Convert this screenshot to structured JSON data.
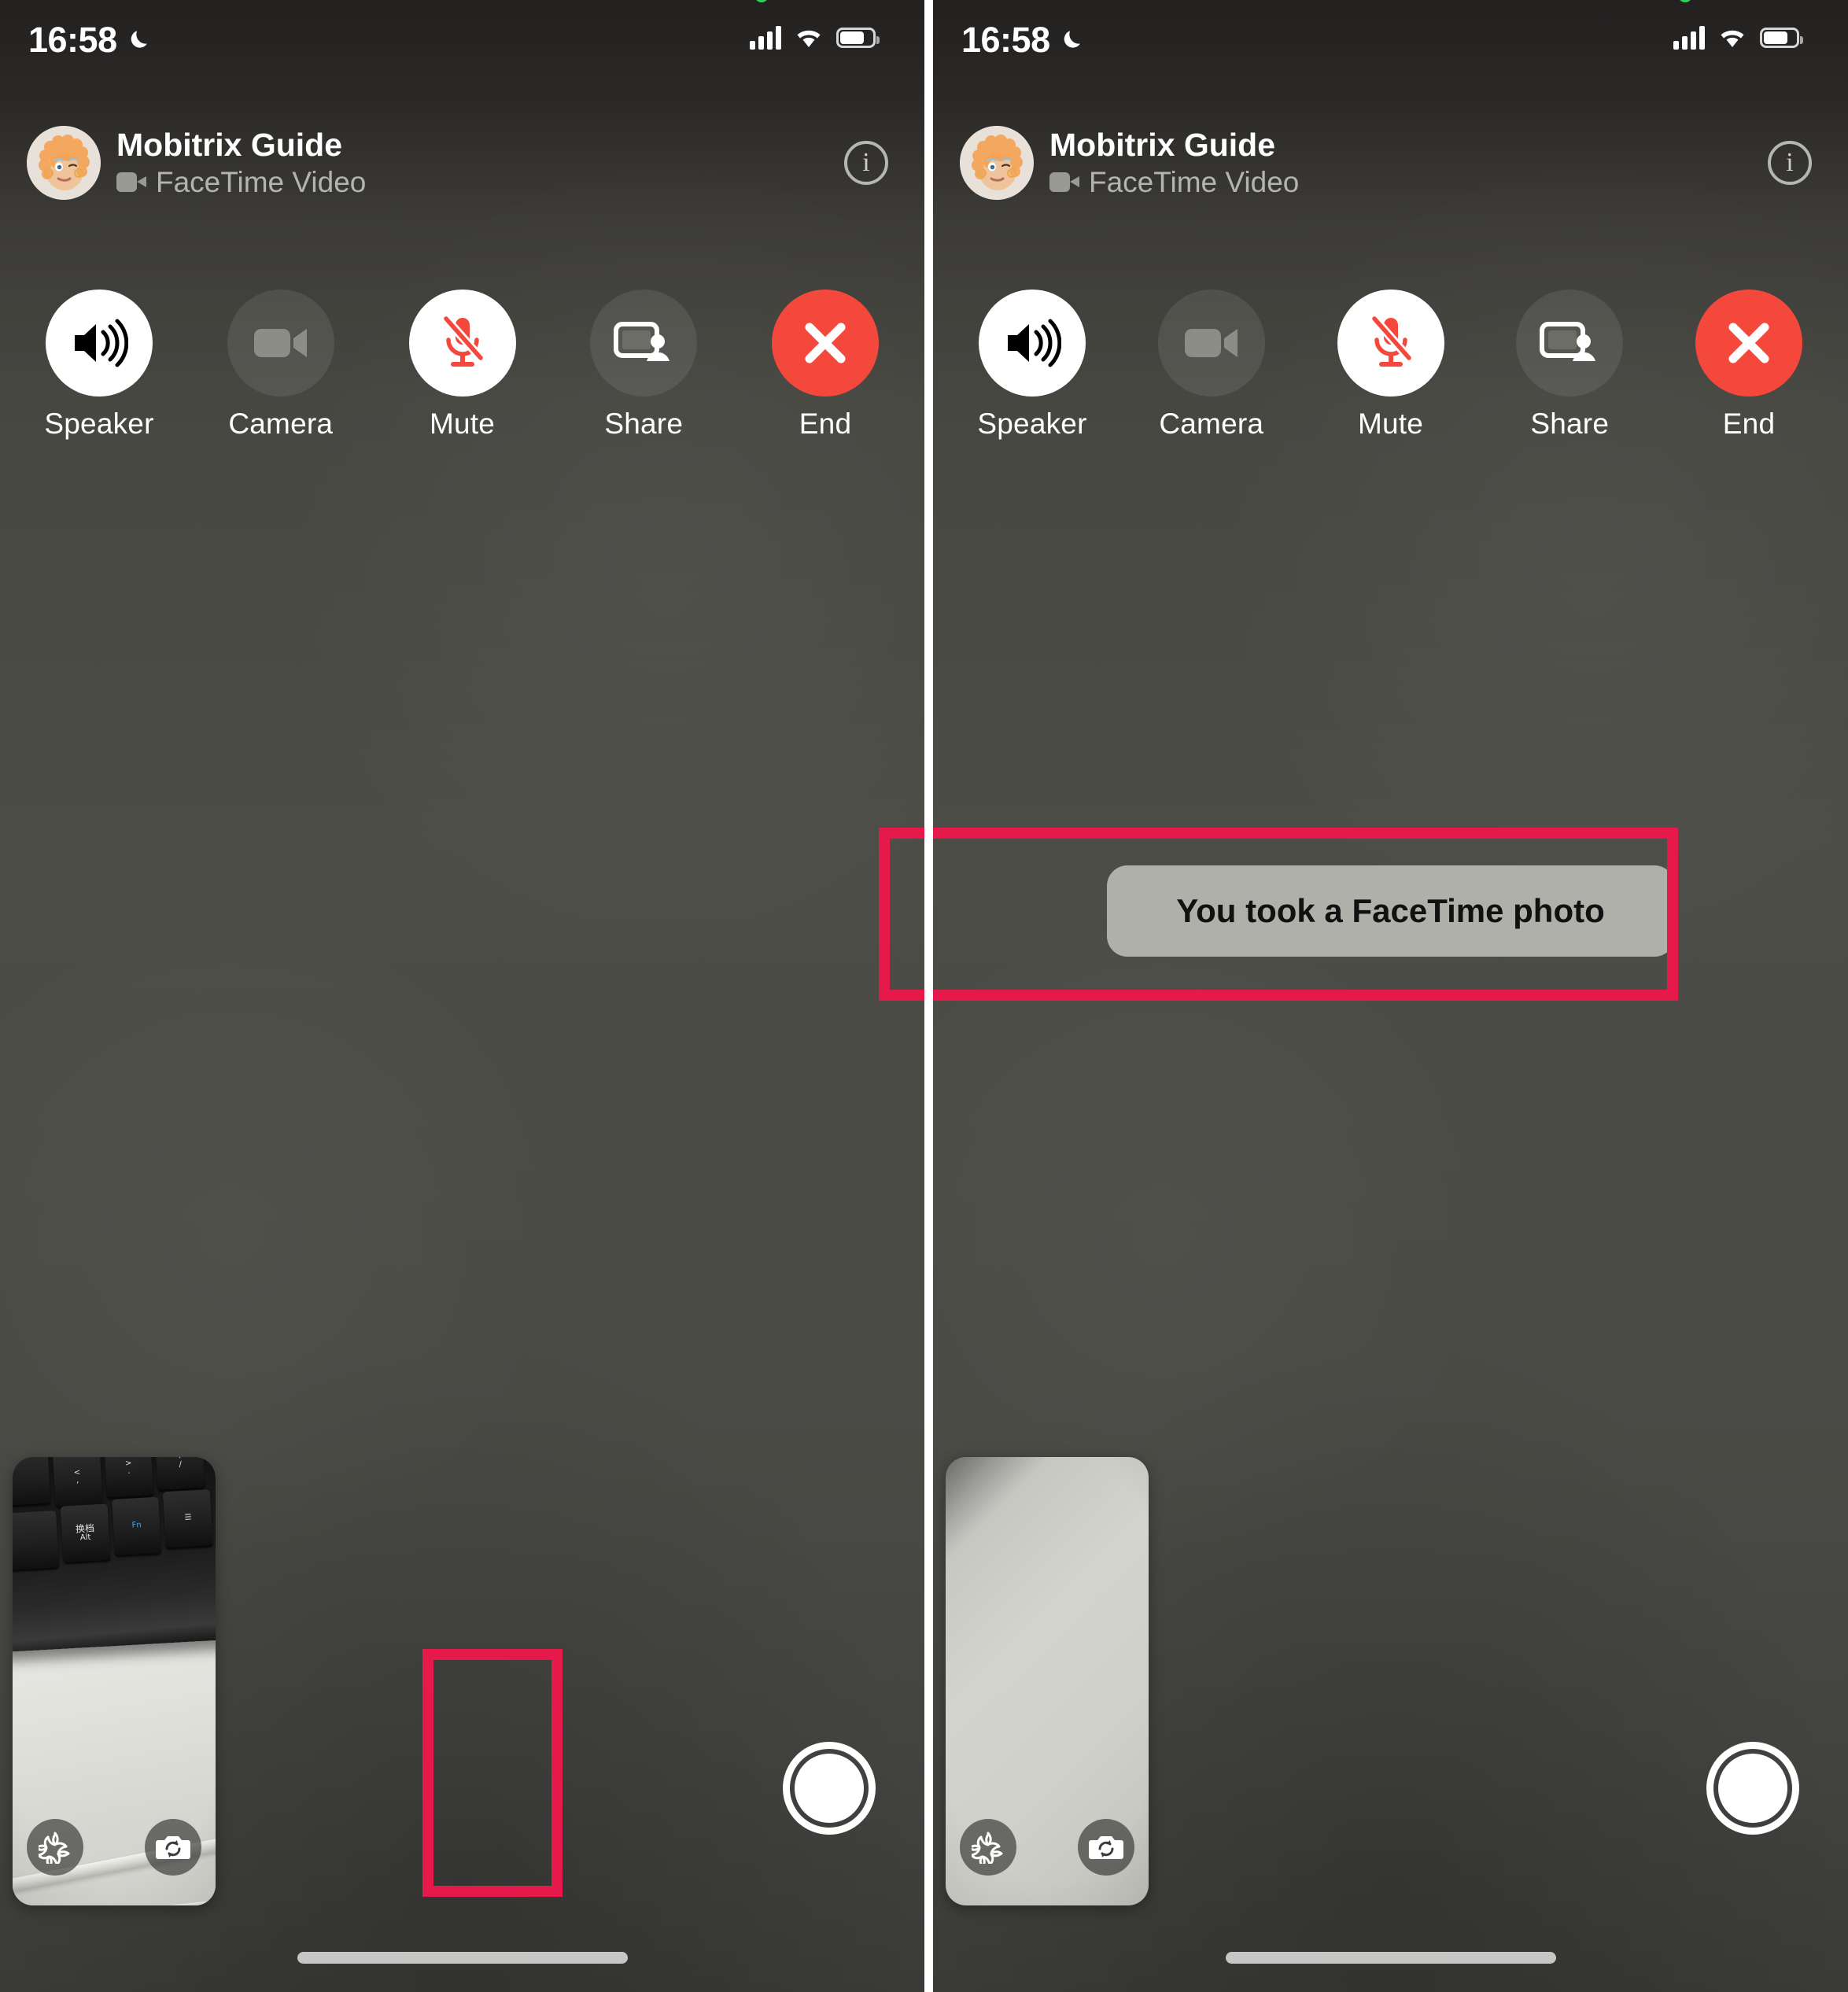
{
  "meta": {
    "app": "FaceTime",
    "panels": 2,
    "accent_red": "#f5483c",
    "annotation_color": "#e6194b",
    "background": "#4a4a45"
  },
  "status_bar": {
    "time": "16:58",
    "moon_icon": "crescent-moon-do-not-disturb-icon",
    "recording_dot": "green-privacy-dot",
    "cellular_icon": "cellular-signal-bars-icon",
    "wifi_icon": "wifi-icon",
    "battery_icon": "battery-icon"
  },
  "caller": {
    "avatar": "memoji-avatar",
    "name": "Mobitrix  Guide",
    "call_type": "FaceTime Video",
    "call_type_icon": "video-camera-icon",
    "info_label": "i",
    "info_icon": "info-circle-icon"
  },
  "controls": [
    {
      "id": "speaker",
      "label": "Speaker",
      "icon": "speaker-wave-icon",
      "style": "light",
      "icon_color": "#000000"
    },
    {
      "id": "camera",
      "label": "Camera",
      "icon": "video-camera-icon",
      "style": "dim",
      "icon_color": "#8d8d88"
    },
    {
      "id": "mute",
      "label": "Mute",
      "icon": "microphone-slash-icon",
      "style": "light",
      "icon_color": "#f5483c"
    },
    {
      "id": "share",
      "label": "Share",
      "icon": "shareplay-screen-person-icon",
      "style": "dim",
      "icon_color": "#ffffff"
    },
    {
      "id": "end",
      "label": "End",
      "icon": "close-x-icon",
      "style": "red",
      "icon_color": "#ffffff"
    }
  ],
  "pip": {
    "effects_icon": "effects-star-pinwheel-icon",
    "flip_icon": "flip-camera-icon",
    "left_scene": {
      "description": "keyboard-and-cable-photo",
      "keys": [
        {
          "label": "<",
          "sub": ","
        },
        {
          "label": ">",
          "sub": "."
        },
        {
          "label": "?",
          "sub": "/"
        },
        {
          "label": "换档",
          "sub": "Alt"
        },
        {
          "label": "Fn",
          "sub": ""
        },
        {
          "label": "☰",
          "sub": ""
        }
      ]
    },
    "right_scene": {
      "description": "plain-white-surface-photo"
    }
  },
  "shutter": {
    "label": "take-facetime-photo",
    "icon": "shutter-button-icon"
  },
  "toast": {
    "text": "You took a FaceTime photo"
  },
  "home_indicator": "home-indicator-bar",
  "annotations": [
    {
      "id": "shutter-highlight",
      "target": "shutter-button"
    },
    {
      "id": "toast-highlight",
      "target": "facetime-photo-toast"
    }
  ]
}
